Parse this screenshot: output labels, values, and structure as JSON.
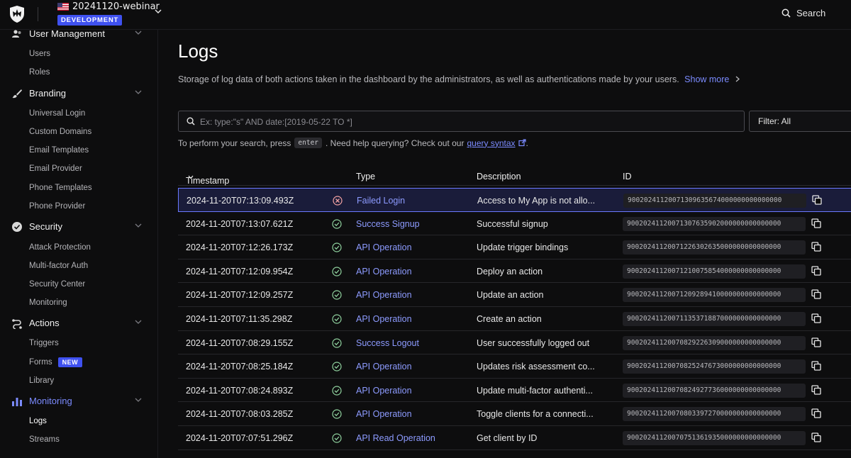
{
  "header": {
    "tenant_name": "20241120-webinar",
    "environment_badge": "DEVELOPMENT",
    "search_label": "Search"
  },
  "sidebar": {
    "sections": [
      {
        "label": "User Management",
        "icon": "users-icon",
        "items": [
          "Users",
          "Roles"
        ]
      },
      {
        "label": "Branding",
        "icon": "brush-icon",
        "items": [
          "Universal Login",
          "Custom Domains",
          "Email Templates",
          "Email Provider",
          "Phone Templates",
          "Phone Provider"
        ]
      },
      {
        "label": "Security",
        "icon": "shield-check-icon",
        "items": [
          "Attack Protection",
          "Multi-factor Auth",
          "Security Center",
          "Monitoring"
        ]
      },
      {
        "label": "Actions",
        "icon": "actions-icon",
        "items": [
          "Triggers",
          "Forms",
          "Library"
        ]
      },
      {
        "label": "Monitoring",
        "icon": "bar-chart-icon",
        "items": [
          "Logs",
          "Streams"
        ]
      }
    ],
    "new_badge": "NEW",
    "active_item": "Logs"
  },
  "page": {
    "title": "Logs",
    "description": "Storage of log data of both actions taken in the dashboard by the administrators, as well as authentications made by your users.",
    "show_more": "Show more",
    "search_placeholder": "Ex: type:\"s\" AND date:[2019-05-22 TO *]",
    "filter_label": "Filter:  All",
    "hint_prefix": "To perform your search, press",
    "hint_key": "enter",
    "hint_middle": ". Need help querying? Check out our",
    "hint_link": "query syntax",
    "hint_suffix": "."
  },
  "table": {
    "columns": [
      "Timestamp",
      "Type",
      "Description",
      "ID"
    ],
    "rows": [
      {
        "timestamp": "2024-11-20T07:13:09.493Z",
        "status": "error",
        "type": "Failed Login",
        "description": "Access to My App is not allo...",
        "id": "90020241120071309635674000000000000000"
      },
      {
        "timestamp": "2024-11-20T07:13:07.621Z",
        "status": "success",
        "type": "Success Signup",
        "description": "Successful signup",
        "id": "90020241120071307635902000000000000000"
      },
      {
        "timestamp": "2024-11-20T07:12:26.173Z",
        "status": "success",
        "type": "API Operation",
        "description": "Update trigger bindings",
        "id": "90020241120071226302635000000000000000"
      },
      {
        "timestamp": "2024-11-20T07:12:09.954Z",
        "status": "success",
        "type": "API Operation",
        "description": "Deploy an action",
        "id": "90020241120071210075854000000000000000"
      },
      {
        "timestamp": "2024-11-20T07:12:09.257Z",
        "status": "success",
        "type": "API Operation",
        "description": "Update an action",
        "id": "90020241120071209289410000000000000000"
      },
      {
        "timestamp": "2024-11-20T07:11:35.298Z",
        "status": "success",
        "type": "API Operation",
        "description": "Create an action",
        "id": "90020241120071135371887000000000000000"
      },
      {
        "timestamp": "2024-11-20T07:08:29.155Z",
        "status": "success",
        "type": "Success Logout",
        "description": "User successfully logged out",
        "id": "90020241120070829226309000000000000000"
      },
      {
        "timestamp": "2024-11-20T07:08:25.184Z",
        "status": "success",
        "type": "API Operation",
        "description": "Updates risk assessment co...",
        "id": "90020241120070825247673000000000000000"
      },
      {
        "timestamp": "2024-11-20T07:08:24.893Z",
        "status": "success",
        "type": "API Operation",
        "description": "Update multi-factor authenti...",
        "id": "90020241120070824927736000000000000000"
      },
      {
        "timestamp": "2024-11-20T07:08:03.285Z",
        "status": "success",
        "type": "API Operation",
        "description": "Toggle clients for a connecti...",
        "id": "90020241120070803397270000000000000000"
      },
      {
        "timestamp": "2024-11-20T07:07:51.296Z",
        "status": "success",
        "type": "API Read Operation",
        "description": "Get client by ID",
        "id": "90020241120070751361935000000000000000"
      }
    ]
  },
  "colors": {
    "accent": "#3f51f0",
    "link": "#8d9bff",
    "success": "#8fd19e",
    "error": "#f5a3a3"
  }
}
